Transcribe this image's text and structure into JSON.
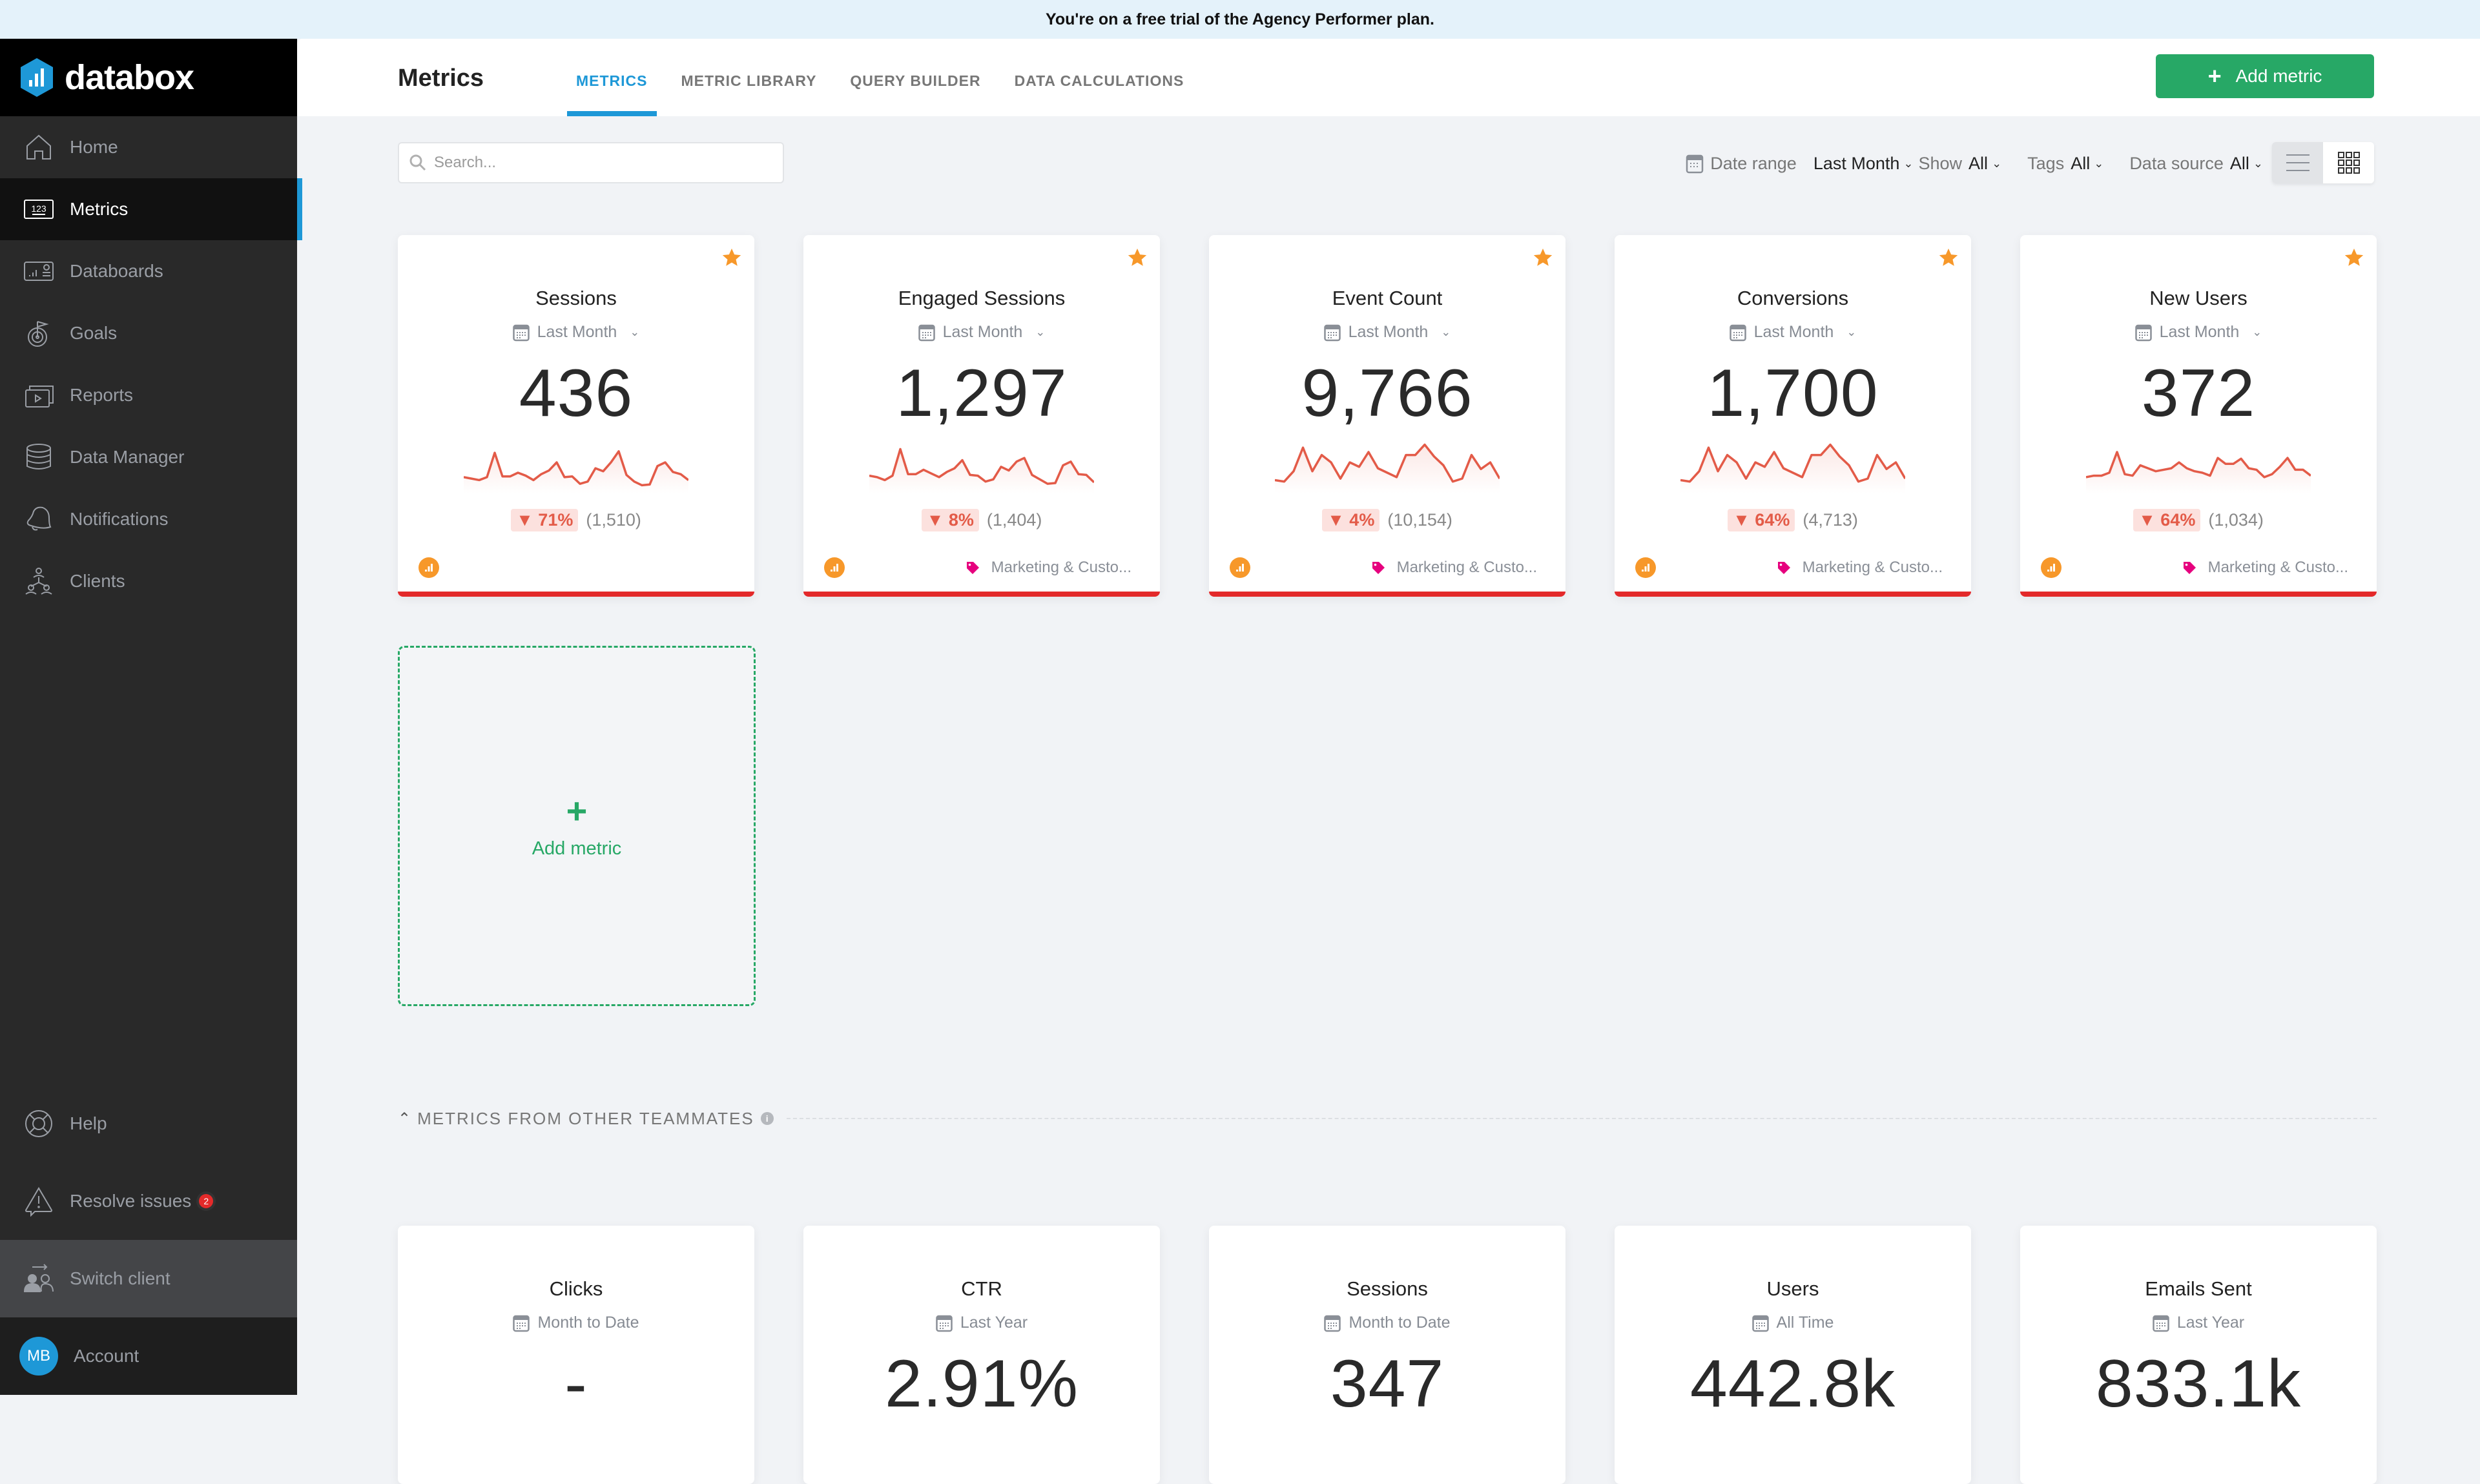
{
  "banner": {
    "text": "You're on a free trial of the Agency Performer plan."
  },
  "brand": {
    "name": "databox"
  },
  "sidebar": {
    "items": [
      {
        "label": "Home",
        "icon": "home-icon"
      },
      {
        "label": "Metrics",
        "icon": "metrics-123-icon",
        "active": true
      },
      {
        "label": "Databoards",
        "icon": "databoards-icon"
      },
      {
        "label": "Goals",
        "icon": "goals-target-icon"
      },
      {
        "label": "Reports",
        "icon": "reports-icon"
      },
      {
        "label": "Data Manager",
        "icon": "database-icon"
      },
      {
        "label": "Notifications",
        "icon": "bell-icon"
      },
      {
        "label": "Clients",
        "icon": "clients-icon"
      }
    ],
    "bottom": {
      "help": "Help",
      "resolve": "Resolve issues",
      "resolve_count": "2",
      "switch_client": "Switch client",
      "account": "Account",
      "avatar_initials": "MB"
    }
  },
  "header": {
    "title": "Metrics",
    "tabs": [
      {
        "label": "METRICS",
        "active": true
      },
      {
        "label": "METRIC LIBRARY"
      },
      {
        "label": "QUERY BUILDER"
      },
      {
        "label": "DATA CALCULATIONS"
      }
    ],
    "add_button": "Add metric"
  },
  "toolbar": {
    "search_placeholder": "Search...",
    "search_value": "",
    "date_range_label": "Date range",
    "date_range_value": "Last Month",
    "show_label": "Show",
    "show_value": "All",
    "tags_label": "Tags",
    "tags_value": "All",
    "data_source_label": "Data source",
    "data_source_value": "All",
    "view_mode": "grid"
  },
  "metrics": [
    {
      "title": "Sessions",
      "date": "Last Month",
      "value": "436",
      "delta": "▼ 71%",
      "previous": "(1,510)",
      "tag": "",
      "favorite": true,
      "spark": [
        22,
        20,
        18,
        22,
        55,
        23,
        23,
        28,
        24,
        18,
        26,
        31,
        42,
        22,
        23,
        13,
        16,
        34,
        30,
        42,
        57,
        25,
        16,
        11,
        12,
        37,
        42,
        29,
        26,
        18
      ]
    },
    {
      "title": "Engaged Sessions",
      "date": "Last Month",
      "value": "1,297",
      "delta": "▼ 8%",
      "previous": "(1,404)",
      "tag": "Marketing & Custo...",
      "favorite": true,
      "spark": [
        24,
        22,
        18,
        24,
        60,
        26,
        26,
        32,
        27,
        22,
        29,
        34,
        45,
        25,
        24,
        16,
        19,
        36,
        31,
        43,
        48,
        25,
        19,
        13,
        14,
        38,
        43,
        26,
        25,
        15
      ]
    },
    {
      "title": "Event Count",
      "date": "Last Month",
      "value": "9,766",
      "delta": "▼ 4%",
      "previous": "(10,154)",
      "tag": "Marketing & Custo...",
      "favorite": true,
      "spark": [
        18,
        16,
        30,
        62,
        30,
        52,
        42,
        20,
        42,
        36,
        56,
        34,
        28,
        22,
        52,
        52,
        66,
        50,
        38,
        16,
        20,
        52,
        33,
        42,
        20
      ]
    },
    {
      "title": "Conversions",
      "date": "Last Month",
      "value": "1,700",
      "delta": "▼ 64%",
      "previous": "(4,713)",
      "tag": "Marketing & Custo...",
      "favorite": true,
      "spark": [
        18,
        16,
        30,
        62,
        30,
        52,
        42,
        20,
        42,
        36,
        56,
        34,
        28,
        22,
        52,
        52,
        66,
        50,
        38,
        16,
        20,
        52,
        33,
        42,
        20
      ]
    },
    {
      "title": "New Users",
      "date": "Last Month",
      "value": "372",
      "delta": "▼ 64%",
      "previous": "(1,034)",
      "tag": "Marketing & Custo...",
      "favorite": true,
      "spark": [
        22,
        24,
        24,
        28,
        56,
        26,
        24,
        38,
        34,
        30,
        32,
        34,
        42,
        34,
        30,
        28,
        24,
        48,
        40,
        40,
        47,
        34,
        32,
        22,
        26,
        36,
        48,
        32,
        32,
        24
      ]
    }
  ],
  "add_card": {
    "label": "Add metric"
  },
  "teammates": {
    "heading": "METRICS FROM OTHER TEAMMATES",
    "cards": [
      {
        "title": "Clicks",
        "date": "Month to Date",
        "value": "-"
      },
      {
        "title": "CTR",
        "date": "Last Year",
        "value": "2.91%"
      },
      {
        "title": "Sessions",
        "date": "Month to Date",
        "value": "347"
      },
      {
        "title": "Users",
        "date": "All Time",
        "value": "442.8k"
      },
      {
        "title": "Emails Sent",
        "date": "Last Year",
        "value": "833.1k"
      }
    ]
  },
  "colors": {
    "accent": "#1e98d7",
    "primary_button": "#27a866",
    "negative": "#e3292a",
    "favorite_star": "#f7982a",
    "tag": "#e6007e"
  }
}
